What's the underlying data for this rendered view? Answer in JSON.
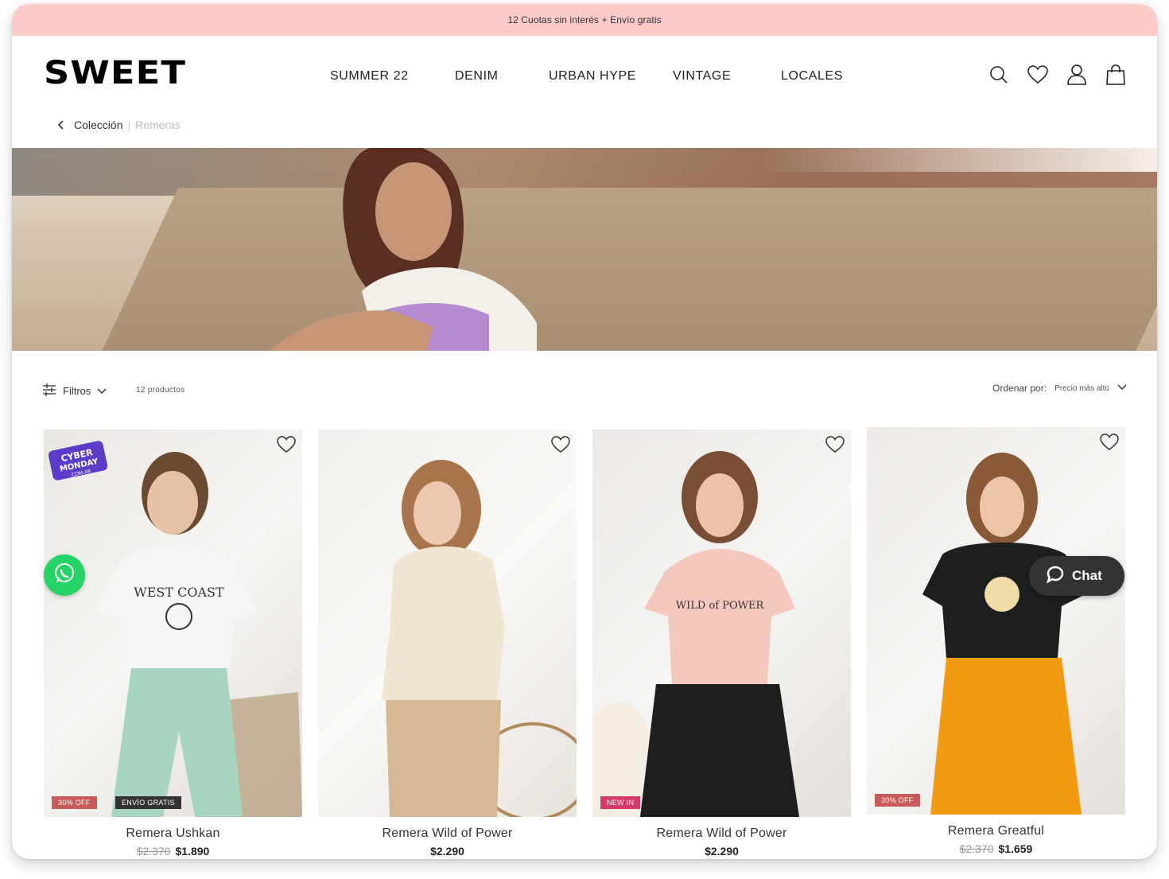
{
  "promo_bar": {
    "text": "12 Cuotas sin interés + Envío gratis"
  },
  "header": {
    "logo": "SWEET",
    "nav": [
      "SUMMER 22",
      "DENIM",
      "URBAN HYPE",
      "VINTAGE",
      "LOCALES"
    ],
    "icons": [
      "search-icon",
      "heart-icon",
      "user-icon",
      "bag-icon"
    ]
  },
  "breadcrumb": {
    "parent": "Colección",
    "current": "Remeras"
  },
  "toolbar": {
    "filters_label": "Filtros",
    "product_count": "12 productos",
    "sort_label": "Ordenar por:",
    "sort_value": "Precio más alto"
  },
  "products": [
    {
      "name": "Remera Ushkan",
      "old_price": "$2.370",
      "price": "$1.890",
      "badges": [
        "30% OFF",
        "ENVÍO GRATIS"
      ],
      "shirt_color": "#f6f6f6",
      "pants_color": "#a8d5c0",
      "promo_sticker": "CYBER MONDAY .COM.AR"
    },
    {
      "name": "Remera Wild of Power",
      "old_price": "",
      "price": "$2.290",
      "badges": [],
      "shirt_color": "#f1e6d2",
      "pants_color": "#d8b894"
    },
    {
      "name": "Remera Wild of Power",
      "old_price": "",
      "price": "$2.290",
      "badges": [
        "NEW IN"
      ],
      "shirt_color": "#f4c8bd",
      "pants_color": "#1e1e1e"
    },
    {
      "name": "Remera Greatful",
      "old_price": "$2.370",
      "price": "$1.659",
      "badges": [
        "30% OFF"
      ],
      "shirt_color": "#1e1e1e",
      "pants_color": "#f29a12"
    }
  ],
  "chat": {
    "label": "Chat"
  },
  "colors": {
    "promo_bg": "#fdcaca",
    "whatsapp": "#25d366",
    "chat_bg": "#333333"
  }
}
